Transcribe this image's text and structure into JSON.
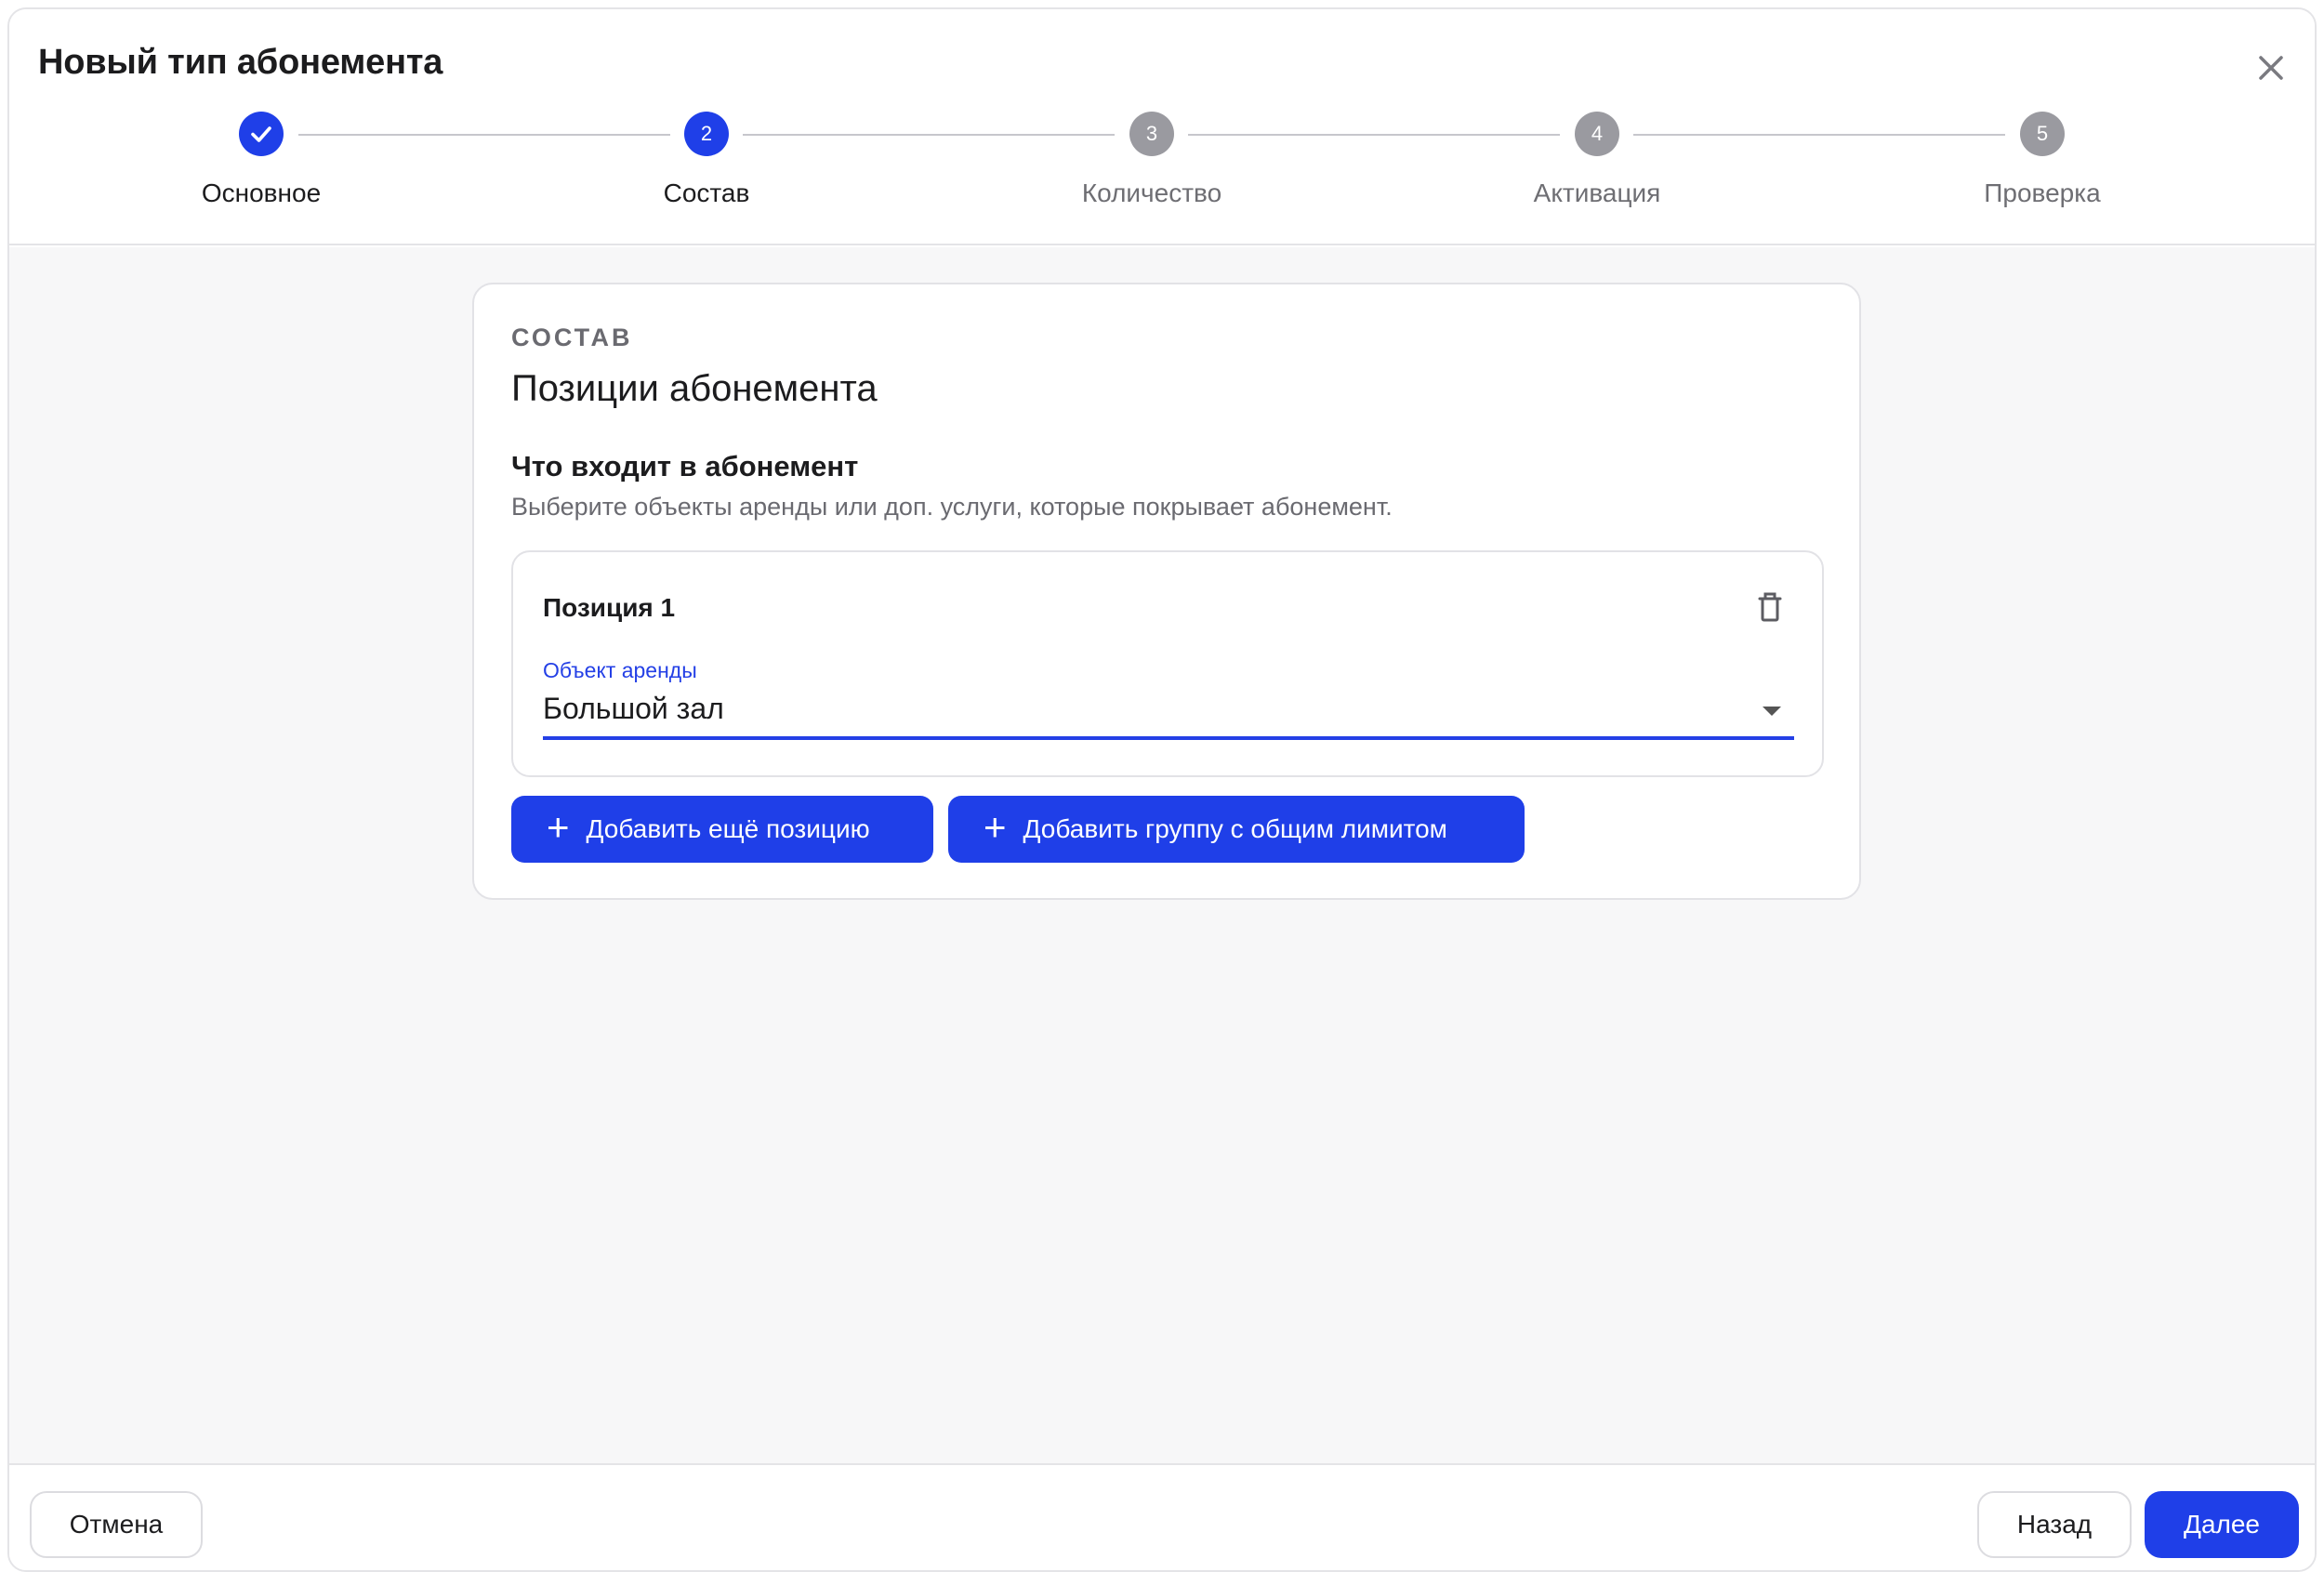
{
  "dialog": {
    "title": "Новый тип абонемента"
  },
  "stepper": {
    "steps": [
      {
        "label": "Основное",
        "number": "1",
        "state": "done"
      },
      {
        "label": "Состав",
        "number": "2",
        "state": "active"
      },
      {
        "label": "Количество",
        "number": "3",
        "state": "pending"
      },
      {
        "label": "Активация",
        "number": "4",
        "state": "pending"
      },
      {
        "label": "Проверка",
        "number": "5",
        "state": "pending"
      }
    ]
  },
  "card": {
    "overline": "СОСТАВ",
    "title": "Позиции абонемента",
    "section_title": "Что входит в абонемент",
    "section_desc": "Выберите объекты аренды или доп. услуги, которые покрывает абонемент.",
    "position": {
      "title": "Позиция 1",
      "field_label": "Объект аренды",
      "field_value": "Большой зал"
    },
    "add_position_label": "Добавить ещё позицию",
    "add_group_label": "Добавить группу с общим лимитом"
  },
  "footer": {
    "cancel_label": "Отмена",
    "back_label": "Назад",
    "next_label": "Далее"
  },
  "colors": {
    "accent": "#1f3fe8",
    "pending_step": "#9a9aa0",
    "content_bg": "#f7f7f8"
  }
}
